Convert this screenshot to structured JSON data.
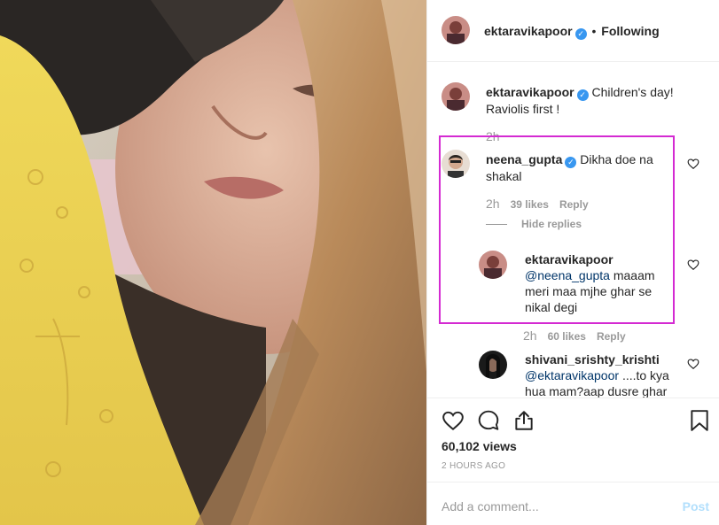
{
  "header": {
    "username": "ektaravikapoor",
    "separator": "•",
    "follow_status": "Following"
  },
  "caption": {
    "username": "ektaravikapoor",
    "text": "Children's day! Raviolis first !",
    "time": "2h"
  },
  "comment1": {
    "username": "neena_gupta",
    "text": "Dikha doe na shakal",
    "time": "2h",
    "likes": "39 likes",
    "reply_label": "Reply",
    "hide_replies": "Hide replies"
  },
  "reply1": {
    "username": "ektaravikapoor",
    "mention": "@neena_gupta",
    "text": "maaam meri maa mjhe ghar se nikal degi",
    "time": "2h",
    "likes": "60 likes",
    "reply_label": "Reply"
  },
  "comment2": {
    "username": "shivani_srishty_krishti",
    "mention": "@ektaravikapoor",
    "text": "....to kya hua mam?aap dusre ghar"
  },
  "stats": {
    "views": "60,102 views",
    "posted": "2 HOURS AGO"
  },
  "add_comment": {
    "placeholder": "Add a comment...",
    "post_label": "Post"
  },
  "icons": {
    "like": "heart-icon",
    "comment": "comment-bubble-icon",
    "share": "share-icon",
    "save": "bookmark-icon",
    "verified": "verified-badge-icon"
  },
  "colors": {
    "verified": "#3897f0",
    "highlight_box": "#d42ad2",
    "post_disabled": "#b2dffc",
    "mention": "#003569"
  }
}
